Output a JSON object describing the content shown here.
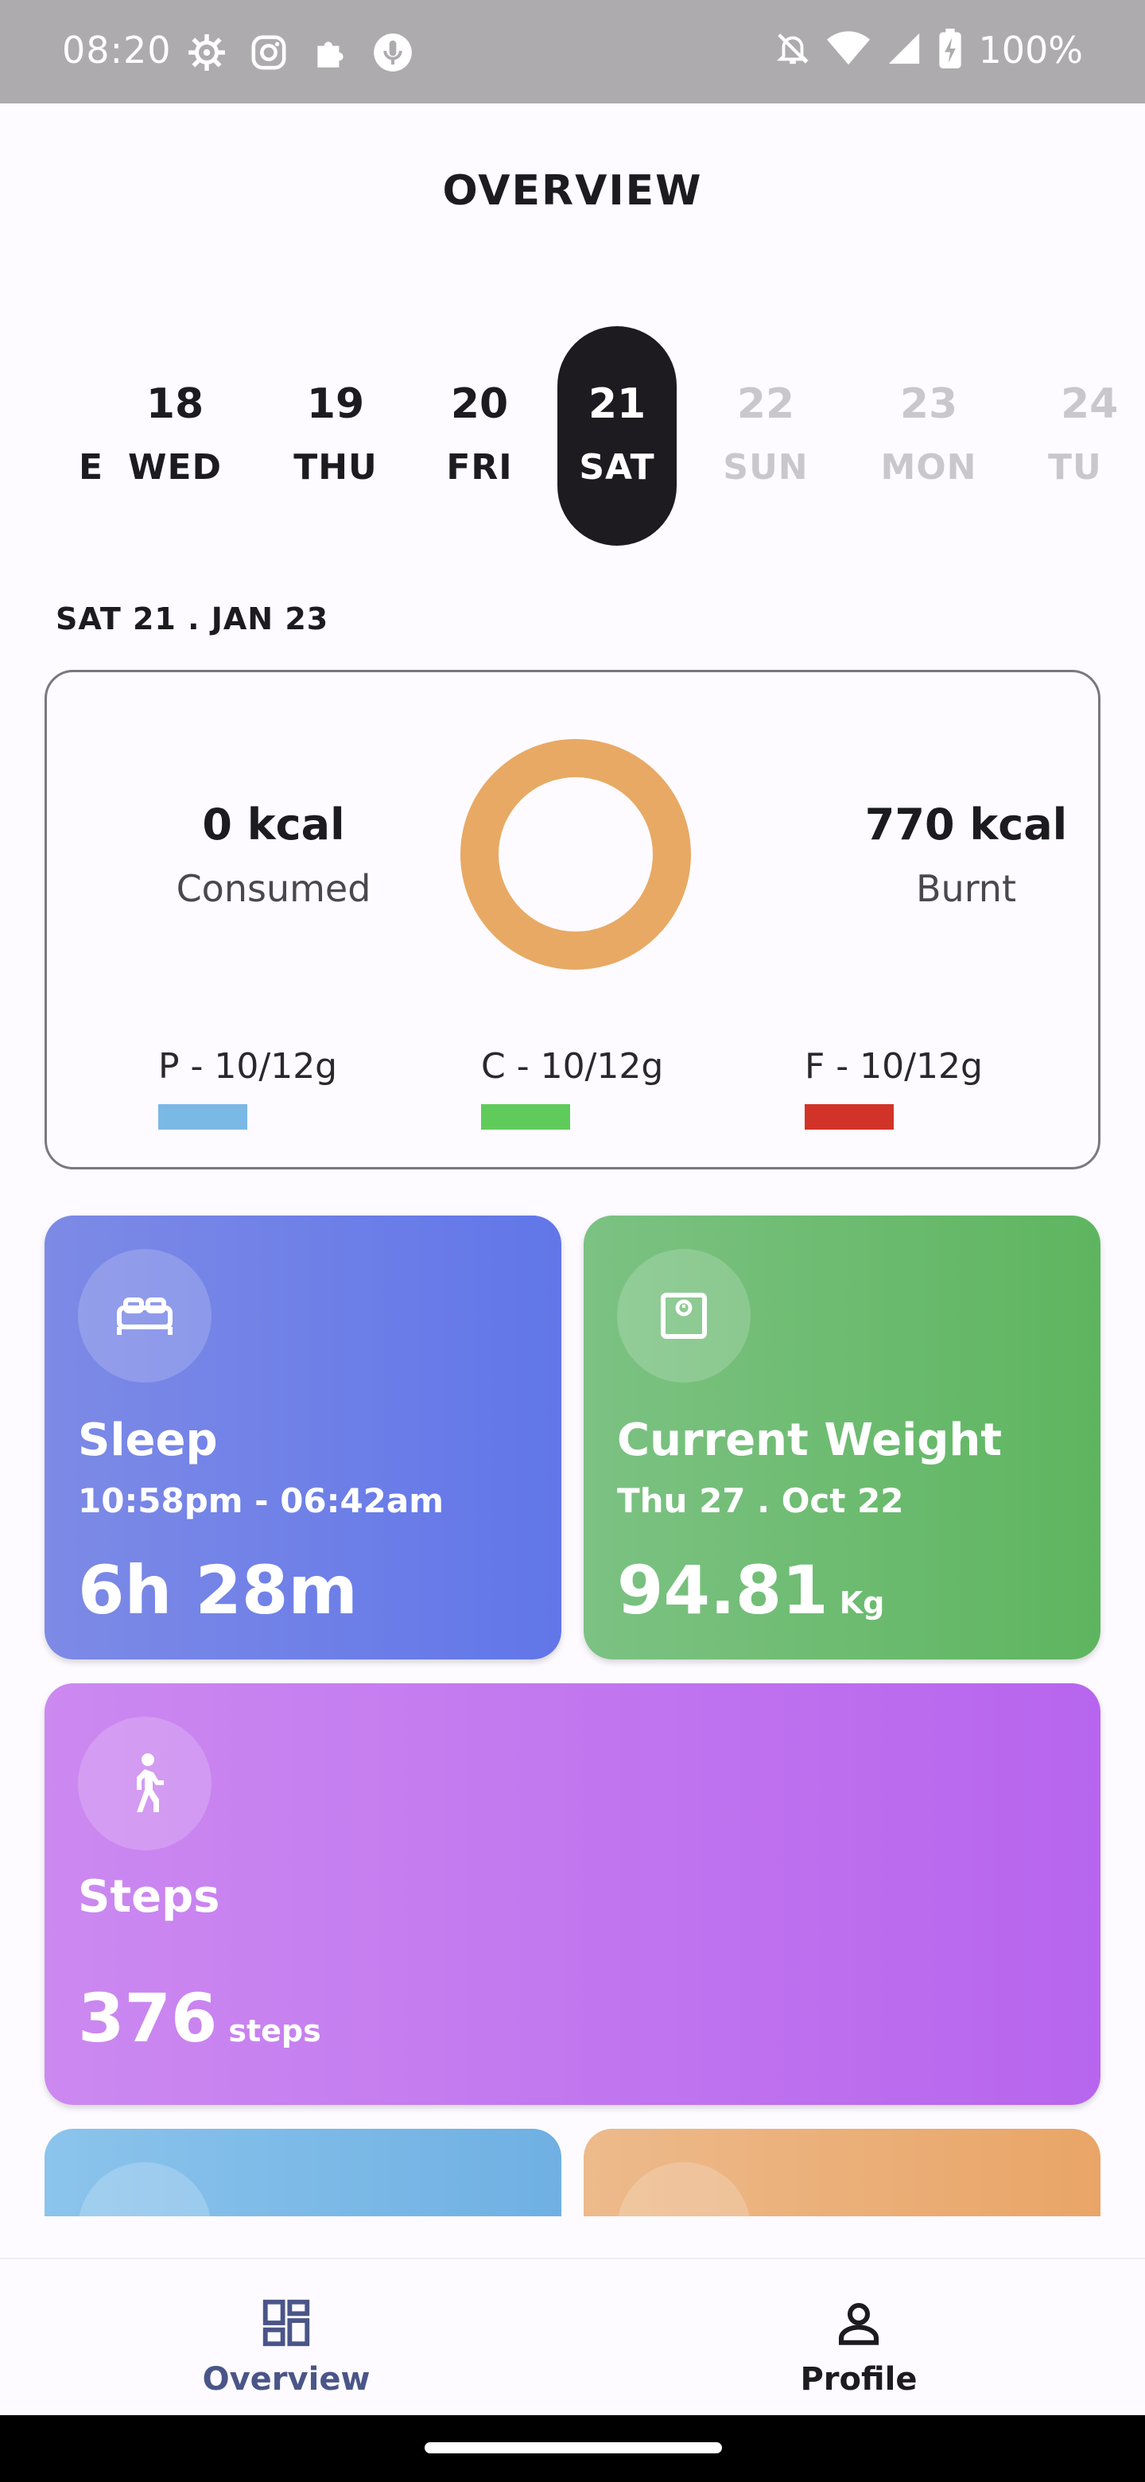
{
  "status_bar": {
    "time": "08:20",
    "battery": "100%",
    "icons": [
      "settings-icon",
      "instagram-icon",
      "puzzle-icon",
      "podcast-icon",
      "bell-off-icon",
      "wifi-icon",
      "signal-icon",
      "battery-charging-icon"
    ]
  },
  "header": {
    "title": "OVERVIEW"
  },
  "date_strip": {
    "days": [
      {
        "num": "",
        "name": "E",
        "state": "past"
      },
      {
        "num": "18",
        "name": "WED",
        "state": "past"
      },
      {
        "num": "19",
        "name": "THU",
        "state": "past"
      },
      {
        "num": "20",
        "name": "FRI",
        "state": "past"
      },
      {
        "num": "21",
        "name": "SAT",
        "state": "active"
      },
      {
        "num": "22",
        "name": "SUN",
        "state": "future"
      },
      {
        "num": "23",
        "name": "MON",
        "state": "future"
      },
      {
        "num": "24",
        "name": "TU",
        "state": "future"
      }
    ]
  },
  "selected_date": "SAT 21 . JAN 23",
  "calories": {
    "consumed_value": "0 kcal",
    "consumed_label": "Consumed",
    "burnt_value": "770 kcal",
    "burnt_label": "Burnt",
    "ring_color": "#e8a964",
    "macros": [
      {
        "label": "P - 10/12g",
        "color": "#7ab8e6"
      },
      {
        "label": "C - 10/12g",
        "color": "#5fcb5b"
      },
      {
        "label": "F - 10/12g",
        "color": "#d23328"
      }
    ]
  },
  "tiles": {
    "sleep": {
      "title": "Sleep",
      "subtitle": "10:58pm - 06:42am",
      "value": "6h 28m",
      "icon": "bed-icon"
    },
    "weight": {
      "title": "Current Weight",
      "subtitle": "Thu 27 . Oct 22",
      "value": "94.81",
      "unit": "Kg",
      "icon": "scale-icon"
    },
    "steps": {
      "title": "Steps",
      "value": "376",
      "unit": "steps",
      "icon": "walking-icon"
    }
  },
  "bottom_nav": {
    "items": [
      {
        "label": "Overview",
        "icon": "dashboard-icon",
        "active": true
      },
      {
        "label": "Profile",
        "icon": "person-icon",
        "active": false
      }
    ]
  }
}
